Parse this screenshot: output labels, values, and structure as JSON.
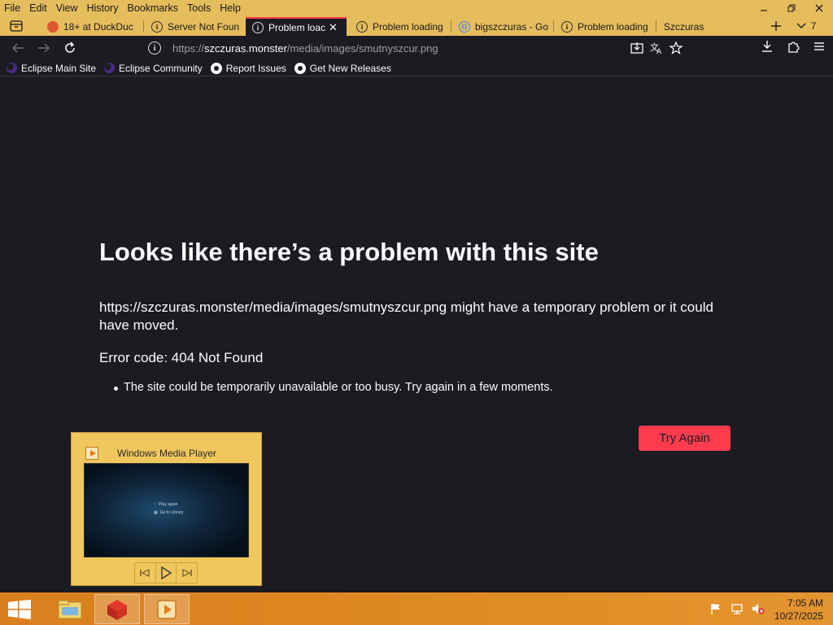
{
  "menu": [
    "File",
    "Edit",
    "View",
    "History",
    "Bookmarks",
    "Tools",
    "Help"
  ],
  "tabs": [
    {
      "label": "18+ at DuckDuc",
      "active": false
    },
    {
      "label": "Server Not Foun",
      "active": false
    },
    {
      "label": "Problem loac",
      "active": true
    },
    {
      "label": "Problem loading",
      "active": false
    },
    {
      "label": "bigszczuras - Go",
      "active": false
    },
    {
      "label": "Problem loading",
      "active": false
    },
    {
      "label": "Szczuras",
      "active": false
    }
  ],
  "tab_count": "7",
  "url": {
    "prefix": "https://",
    "host": "szczuras.monster",
    "path": "/media/images/smutnyszcur.png"
  },
  "bookmarks": [
    "Eclipse Main Site",
    "Eclipse Community",
    "Report Issues",
    "Get New Releases"
  ],
  "error": {
    "title": "Looks like there’s a problem with this site",
    "description": "https://szczuras.monster/media/images/smutnyszcur.png might have a temporary problem or it could have moved.",
    "code": "Error code: 404 Not Found",
    "reasons": [
      "The site could be temporarily unavailable or too busy. Try again in a few moments."
    ],
    "button": "Try Again"
  },
  "wmp": {
    "title": "Windows Media Player",
    "video_lines": [
      "Play again",
      "Go to Library"
    ]
  },
  "clock": {
    "time": "7:05 AM",
    "date": "10/27/2025"
  },
  "colors": {
    "accent": "#ff3b4e",
    "chrome": "#e6bd5c",
    "background": "#1c1b22"
  }
}
